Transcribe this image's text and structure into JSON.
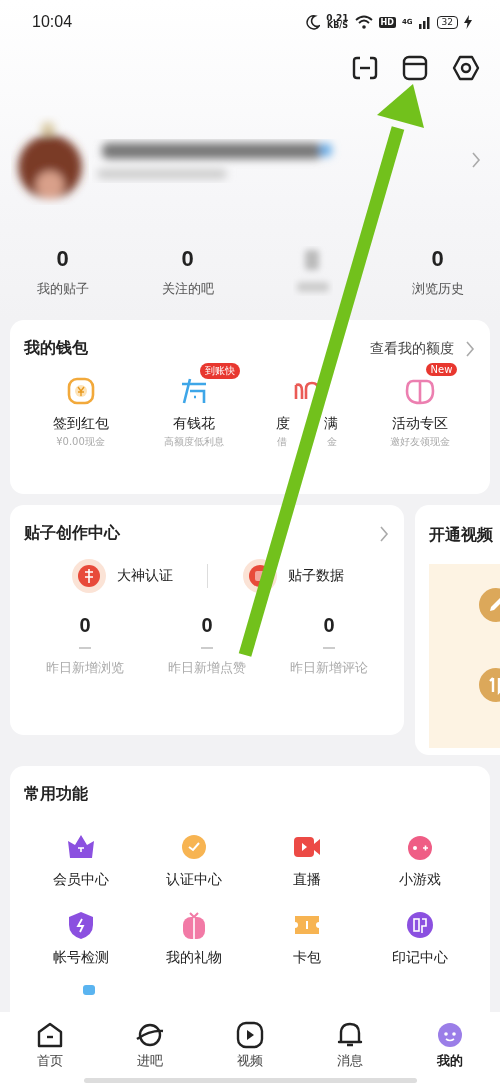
{
  "status_bar": {
    "time": "10:04",
    "net_speed": "0.21",
    "net_unit": "KB/S",
    "hd": "HD",
    "network": "4G",
    "battery": "32"
  },
  "stats": [
    {
      "value": "0",
      "label": "我的贴子"
    },
    {
      "value": "0",
      "label": "关注的吧"
    },
    {
      "value": "0",
      "label": "浏览历史",
      "blurred_before": true
    }
  ],
  "wallet": {
    "title": "我的钱包",
    "link": "查看我的额度",
    "items": [
      {
        "name": "签到红包",
        "sub": "¥0.00现金"
      },
      {
        "name": "有钱花",
        "sub": "高额度低利息",
        "badge": "到账快"
      },
      {
        "name": "度",
        "name_end": "满",
        "sub": "借",
        "sub_end": "金"
      },
      {
        "name": "活动专区",
        "sub": "邀好友领现金",
        "badge": "New"
      }
    ]
  },
  "creator": {
    "title": "贴子创作中心",
    "actions": [
      "大神认证",
      "贴子数据"
    ],
    "metrics": [
      {
        "value": "0",
        "label": "昨日新增浏览"
      },
      {
        "value": "0",
        "label": "昨日新增点赞"
      },
      {
        "value": "0",
        "label": "昨日新增评论"
      }
    ]
  },
  "video_card": {
    "title": "开通视频"
  },
  "functions": {
    "title": "常用功能",
    "items": [
      "会员中心",
      "认证中心",
      "直播",
      "小游戏",
      "帐号检测",
      "我的礼物",
      "卡包",
      "印记中心"
    ]
  },
  "tab_bar": [
    {
      "label": "首页",
      "selected": false
    },
    {
      "label": "进吧",
      "selected": false
    },
    {
      "label": "视频",
      "selected": false
    },
    {
      "label": "消息",
      "selected": false
    },
    {
      "label": "我的",
      "selected": true
    }
  ]
}
